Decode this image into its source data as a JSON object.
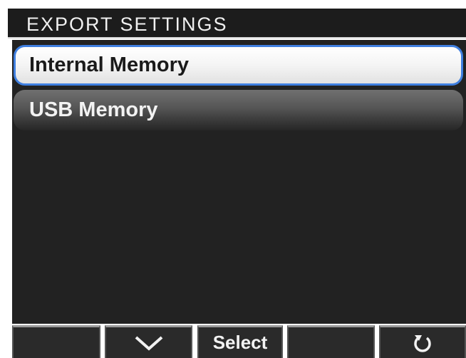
{
  "header": {
    "title": "EXPORT SETTINGS"
  },
  "menu": {
    "items": [
      {
        "label": "Internal Memory",
        "selected": true
      },
      {
        "label": "USB Memory",
        "selected": false
      }
    ]
  },
  "softkeys": [
    {
      "label": "",
      "icon": null
    },
    {
      "label": "",
      "icon": "chevron-down-icon"
    },
    {
      "label": "Select",
      "icon": null
    },
    {
      "label": "",
      "icon": null
    },
    {
      "label": "",
      "icon": "back-arrow-icon"
    }
  ],
  "colors": {
    "background": "#222222",
    "selection_border": "#3f7fe0",
    "title_text": "#f0f0f0"
  }
}
